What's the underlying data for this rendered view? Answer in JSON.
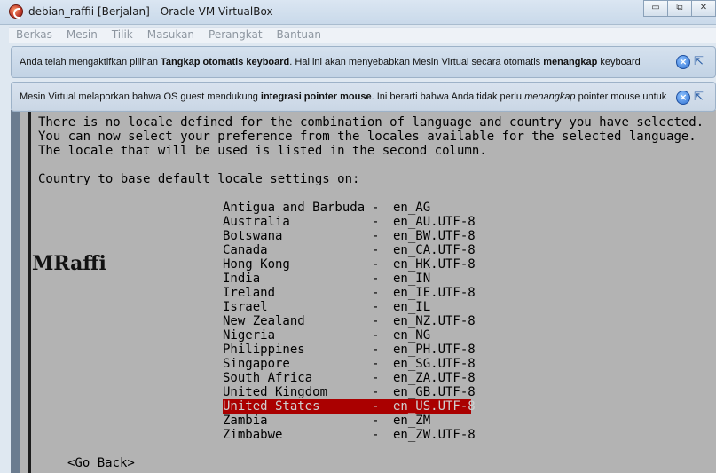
{
  "window": {
    "title": "debian_raffii [Berjalan] - Oracle VM VirtualBox",
    "buttons": {
      "minimize": "▭",
      "restore": "⧉",
      "close": "✕"
    }
  },
  "menubar": {
    "items": [
      "Berkas",
      "Mesin",
      "Tilik",
      "Masukan",
      "Perangkat",
      "Bantuan"
    ]
  },
  "notifications": [
    {
      "prefix": "Anda telah mengaktifkan pilihan ",
      "bold1": "Tangkap otomatis keyboard",
      "middle": ". Hal ini akan menyebabkan Mesin Virtual secara otomatis ",
      "bold2": "menangkap",
      "suffix": " keyboard"
    },
    {
      "prefix": "Mesin Virtual melaporkan bahwa OS guest mendukung ",
      "bold1": "integrasi pointer mouse",
      "middle": ". Ini berarti bahwa Anda tidak perlu ",
      "italic": "menangkap",
      "suffix": " pointer mouse untuk"
    }
  ],
  "guest": {
    "description_lines": [
      "There is no locale defined for the combination of language and country you have selected.",
      "You can now select your preference from the locales available for the selected language.",
      "The locale that will be used is listed in the second column."
    ],
    "prompt": "Country to base default locale settings on:",
    "locales": [
      {
        "country": "Antigua and Barbuda",
        "locale": "en_AG"
      },
      {
        "country": "Australia",
        "locale": "en_AU.UTF-8"
      },
      {
        "country": "Botswana",
        "locale": "en_BW.UTF-8"
      },
      {
        "country": "Canada",
        "locale": "en_CA.UTF-8"
      },
      {
        "country": "Hong Kong",
        "locale": "en_HK.UTF-8"
      },
      {
        "country": "India",
        "locale": "en_IN"
      },
      {
        "country": "Ireland",
        "locale": "en_IE.UTF-8"
      },
      {
        "country": "Israel",
        "locale": "en_IL"
      },
      {
        "country": "New Zealand",
        "locale": "en_NZ.UTF-8"
      },
      {
        "country": "Nigeria",
        "locale": "en_NG"
      },
      {
        "country": "Philippines",
        "locale": "en_PH.UTF-8"
      },
      {
        "country": "Singapore",
        "locale": "en_SG.UTF-8"
      },
      {
        "country": "South Africa",
        "locale": "en_ZA.UTF-8"
      },
      {
        "country": "United Kingdom",
        "locale": "en_GB.UTF-8"
      },
      {
        "country": "United States",
        "locale": "en_US.UTF-8",
        "selected": true
      },
      {
        "country": "Zambia",
        "locale": "en_ZM"
      },
      {
        "country": "Zimbabwe",
        "locale": "en_ZW.UTF-8"
      }
    ],
    "separator": "-",
    "go_back": "<Go Back>",
    "selection_color": "#aa0000"
  },
  "watermark": "MRaffi"
}
